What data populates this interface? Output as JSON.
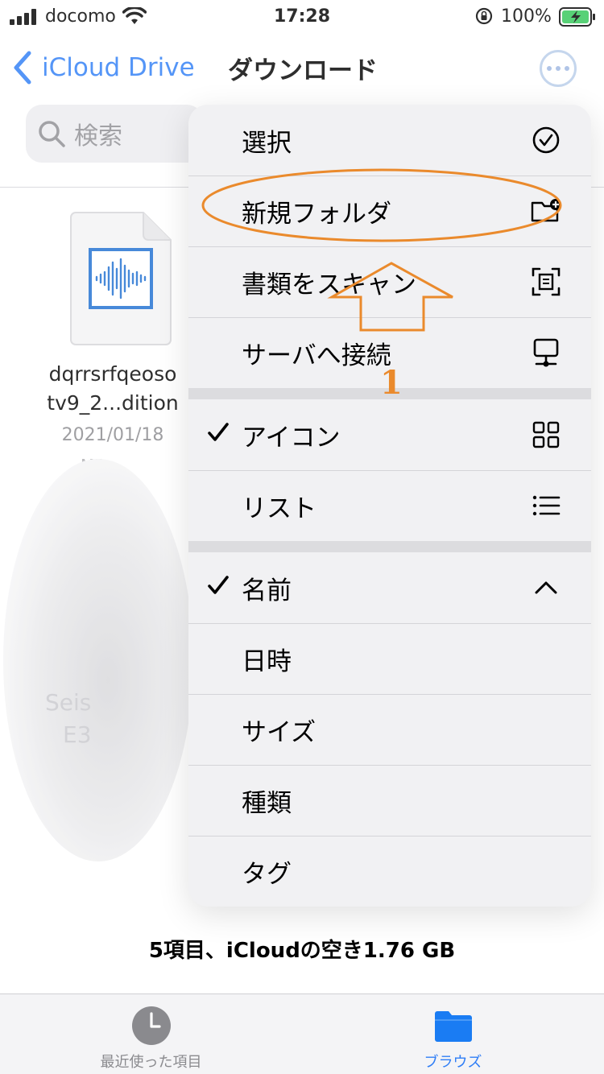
{
  "status_bar": {
    "carrier": "docomo",
    "time": "17:28",
    "battery": "100%"
  },
  "nav": {
    "back_label": "iCloud Drive",
    "title": "ダウンロード"
  },
  "search": {
    "placeholder": "検索"
  },
  "file": {
    "name_line1": "dqrrsrfqeoso",
    "name_line2": "tv9_2...dition",
    "date": "2021/01/18",
    "size_fragment": "MB"
  },
  "blurred_item": {
    "line1": "Seis",
    "line2": "E3"
  },
  "menu": {
    "actions": [
      {
        "label": "選択",
        "icon": "checkmark-circle-icon"
      },
      {
        "label": "新規フォルダ",
        "icon": "folder-plus-icon"
      },
      {
        "label": "書類をスキャン",
        "icon": "document-scan-icon"
      },
      {
        "label": "サーバへ接続",
        "icon": "server-connect-icon"
      }
    ],
    "view_options": [
      {
        "label": "アイコン",
        "icon": "grid-icon",
        "checked": true
      },
      {
        "label": "リスト",
        "icon": "list-icon",
        "checked": false
      }
    ],
    "sort_options": [
      {
        "label": "名前",
        "icon": "chevron-up-icon",
        "checked": true
      },
      {
        "label": "日時",
        "checked": false
      },
      {
        "label": "サイズ",
        "checked": false
      },
      {
        "label": "種類",
        "checked": false
      },
      {
        "label": "タグ",
        "checked": false
      }
    ]
  },
  "annotation": {
    "number": "1",
    "color": "#ea8a2c"
  },
  "storage": {
    "text": "5項目、iCloudの空き1.76 GB"
  },
  "tabs": [
    {
      "label": "最近使った項目",
      "icon": "clock-icon",
      "active": false
    },
    {
      "label": "ブラウズ",
      "icon": "folder-icon",
      "active": true
    }
  ],
  "colors": {
    "accent": "#2f7ef6",
    "inactive": "#8a8a8e"
  }
}
